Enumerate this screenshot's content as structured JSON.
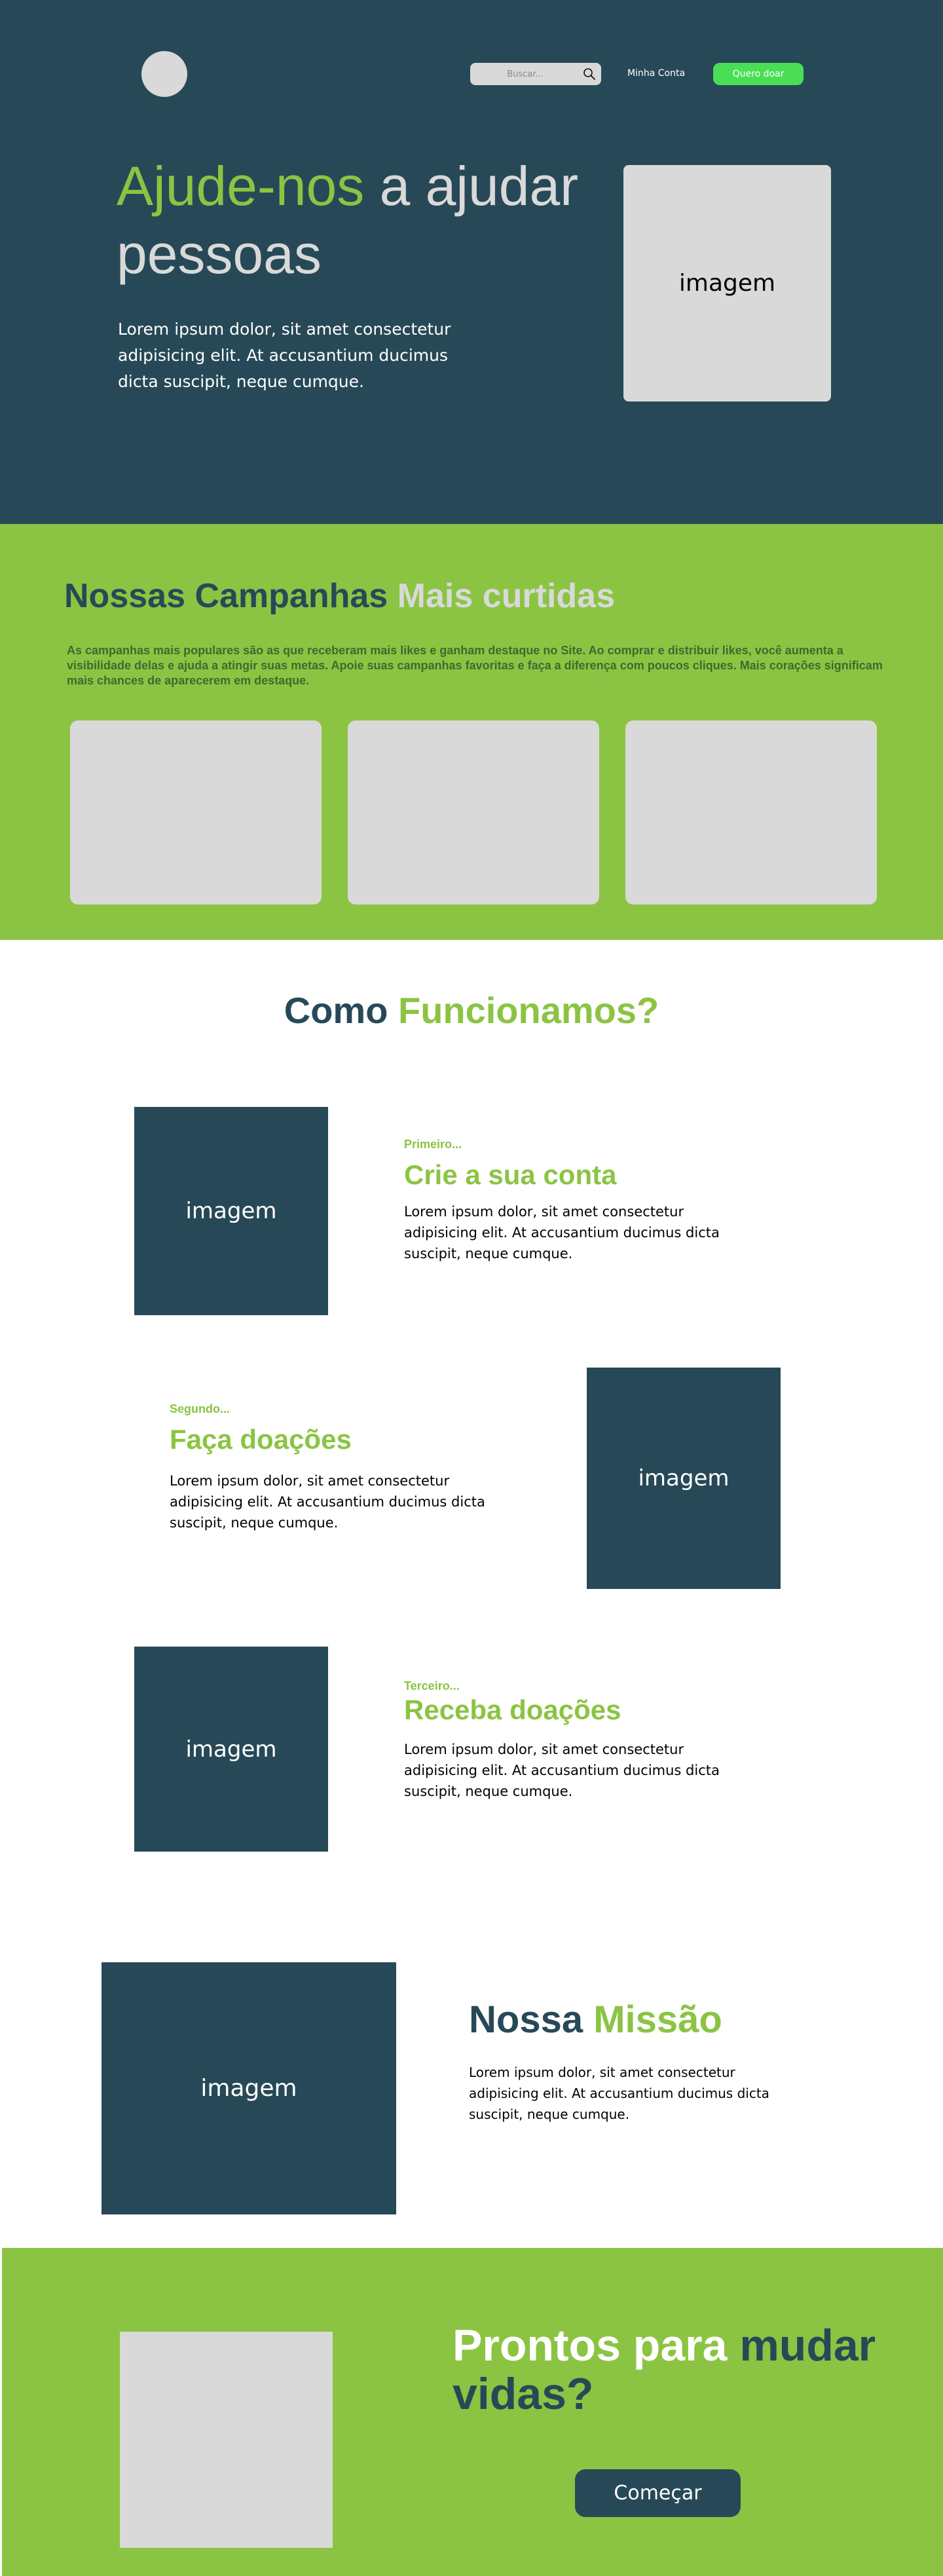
{
  "header": {
    "search_placeholder": "Buscar...",
    "account_link": "Minha Conta",
    "donate_button": "Quero doar"
  },
  "hero": {
    "title_accent": "Ajude-nos",
    "title_rest": " a ajudar pessoas",
    "text": "Lorem ipsum dolor, sit amet consectetur adipisicing elit. At accusantium ducimus dicta suscipit, neque cumque.",
    "image_label": "imagem"
  },
  "campaigns": {
    "title_main": "Nossas Campanhas",
    "title_light": " Mais curtidas",
    "description": "As campanhas mais populares são as que receberam mais likes e ganham destaque no Site. Ao comprar e distribuir likes, você aumenta a visibilidade delas e ajuda a atingir suas metas. Apoie suas campanhas favoritas e faça a diferença com poucos cliques. Mais corações significam mais chances de aparecerem em destaque."
  },
  "how": {
    "title_main": "Como",
    "title_accent": " Funcionamos?",
    "steps": [
      {
        "kicker": "Primeiro...",
        "title": "Crie a sua conta",
        "text": "Lorem ipsum dolor, sit amet consectetur adipisicing elit. At accusantium ducimus dicta suscipit, neque cumque.",
        "image_label": "imagem"
      },
      {
        "kicker": "Segundo...",
        "title": "Faça doações",
        "text": "Lorem ipsum dolor, sit amet consectetur adipisicing elit. At accusantium ducimus dicta suscipit, neque cumque.",
        "image_label": "imagem"
      },
      {
        "kicker": "Terceiro...",
        "title": "Receba doações",
        "text": "Lorem ipsum dolor, sit amet consectetur adipisicing elit. At accusantium ducimus dicta suscipit, neque cumque.",
        "image_label": "imagem"
      }
    ]
  },
  "mission": {
    "title_main": "Nossa",
    "title_accent": " Missão",
    "text": "Lorem ipsum dolor, sit amet consectetur adipisicing elit. At accusantium ducimus dicta suscipit, neque cumque.",
    "image_label": "imagem"
  },
  "cta": {
    "title_light": "Prontos para ",
    "title_dark": "mudar vidas?",
    "button": "Começar"
  },
  "colors": {
    "navy": "#274957",
    "green": "#8bc442",
    "bright_green": "#4ade55",
    "placeholder_gray": "#d9d9d9"
  }
}
